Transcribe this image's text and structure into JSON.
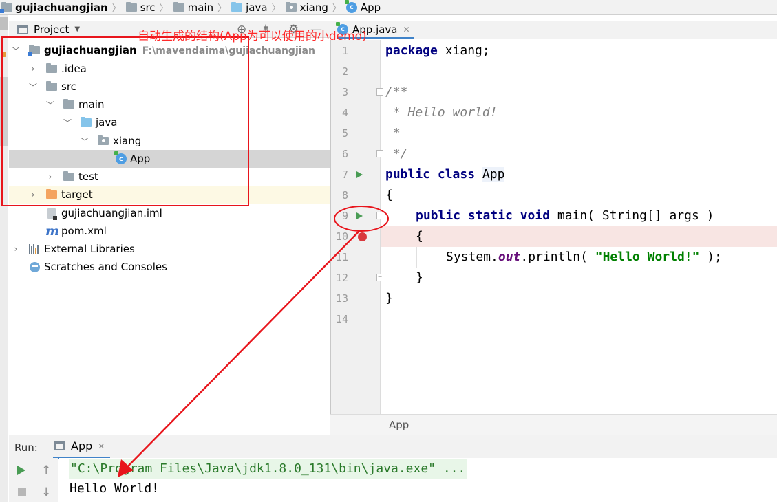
{
  "breadcrumb": [
    "gujiachuangjian",
    "src",
    "main",
    "java",
    "xiang",
    "App"
  ],
  "project_panel": {
    "title": "Project",
    "tree": [
      {
        "label": "gujiachuangjian",
        "path": "F:\\mavendaima\\gujiachuangjian",
        "expanded": true,
        "icon": "module-folder-icon"
      },
      {
        "label": ".idea",
        "expanded": false,
        "icon": "folder-icon"
      },
      {
        "label": "src",
        "expanded": true,
        "icon": "folder-icon"
      },
      {
        "label": "main",
        "expanded": true,
        "icon": "folder-icon"
      },
      {
        "label": "java",
        "expanded": true,
        "icon": "source-folder-icon"
      },
      {
        "label": "xiang",
        "expanded": true,
        "icon": "package-icon"
      },
      {
        "label": "App",
        "selected": true,
        "icon": "java-class-icon"
      },
      {
        "label": "test",
        "expanded": false,
        "icon": "folder-icon"
      },
      {
        "label": "target",
        "expanded": false,
        "icon": "excluded-folder-icon"
      },
      {
        "label": "gujiachuangjian.iml",
        "icon": "iml-file-icon"
      },
      {
        "label": "pom.xml",
        "icon": "maven-icon"
      },
      {
        "label": "External Libraries",
        "expanded": false,
        "icon": "libraries-icon"
      },
      {
        "label": "Scratches and Consoles",
        "icon": "scratches-icon"
      }
    ]
  },
  "annotation": {
    "text": "自动生成的结构(App为可以使用的小demo)",
    "color": "#e8151c"
  },
  "editor": {
    "tab_label": "App.java",
    "line_numbers": [
      "1",
      "2",
      "3",
      "4",
      "5",
      "6",
      "7",
      "8",
      "9",
      "10",
      "11",
      "12",
      "13",
      "14"
    ],
    "code": {
      "l1_kw": "package",
      "l1_rest": " xiang;",
      "l3": "/**",
      "l4": " * Hello world!",
      "l5": " *",
      "l6": " */",
      "l7_kw": "public class",
      "l7_cls": "App",
      "l8": "{",
      "l9_kw": "public static void",
      "l9_rest": " main( String[] args )",
      "l10": "{",
      "l11_a": "System.",
      "l11_field": "out",
      "l11_b": ".println( ",
      "l11_str": "\"Hello World!\"",
      "l11_c": " );",
      "l12": "}",
      "l13": "}"
    },
    "breadcrumb": "App"
  },
  "run_panel": {
    "label": "Run:",
    "tab_label": "App",
    "command": "\"C:\\Program Files\\Java\\jdk1.8.0_131\\bin\\java.exe\" ...",
    "output": "Hello World!"
  },
  "colors": {
    "keyword": "#000080",
    "string": "#008000",
    "comment": "#808080",
    "run_green": "#499c54",
    "breakpoint": "#d9393e",
    "selection": "#d5d5d5"
  }
}
